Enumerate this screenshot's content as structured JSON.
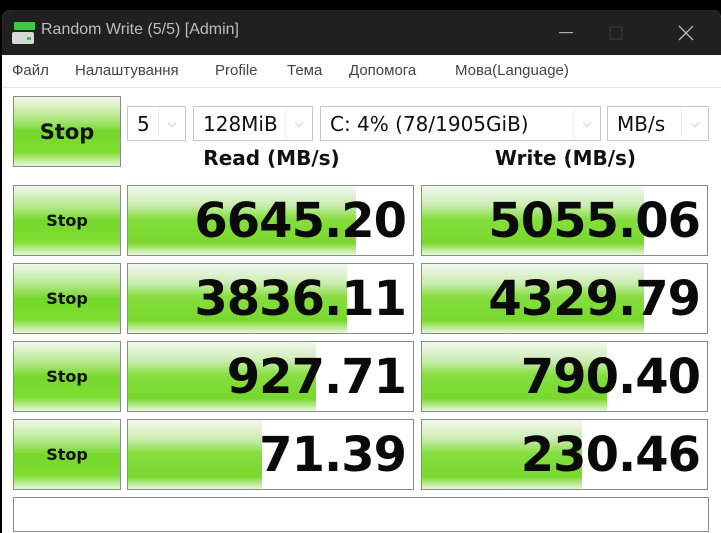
{
  "window": {
    "title": "Random Write (5/5) [Admin]",
    "app_icon": "drive-icon",
    "controls": {
      "minimize": "—",
      "maximize": "☐",
      "close": "✕"
    }
  },
  "menu": [
    {
      "label": "Файл"
    },
    {
      "label": "Налаштування"
    },
    {
      "label": "Profile"
    },
    {
      "label": "Тема"
    },
    {
      "label": "Допомога"
    },
    {
      "label": "Мова(Language)"
    }
  ],
  "controls": {
    "all_button_label": "Stop",
    "count": "5",
    "size": "128MiB",
    "drive": "C: 4% (78/1905GiB)",
    "unit": "MB/s",
    "dropdown_arrow": "⌵"
  },
  "headers": {
    "read": "Read (MB/s)",
    "write": "Write (MB/s)"
  },
  "rows": [
    {
      "button_label": "Stop",
      "read": "6645.20",
      "write": "5055.06",
      "read_fill": 0.8,
      "write_fill": 0.78
    },
    {
      "button_label": "Stop",
      "read": "3836.11",
      "write": "4329.79",
      "read_fill": 0.77,
      "write_fill": 0.78
    },
    {
      "button_label": "Stop",
      "read": "927.71",
      "write": "790.40",
      "read_fill": 0.66,
      "write_fill": 0.65
    },
    {
      "button_label": "Stop",
      "read": "71.39",
      "write": "230.46",
      "read_fill": 0.47,
      "write_fill": 0.56
    }
  ],
  "status_text": ""
}
